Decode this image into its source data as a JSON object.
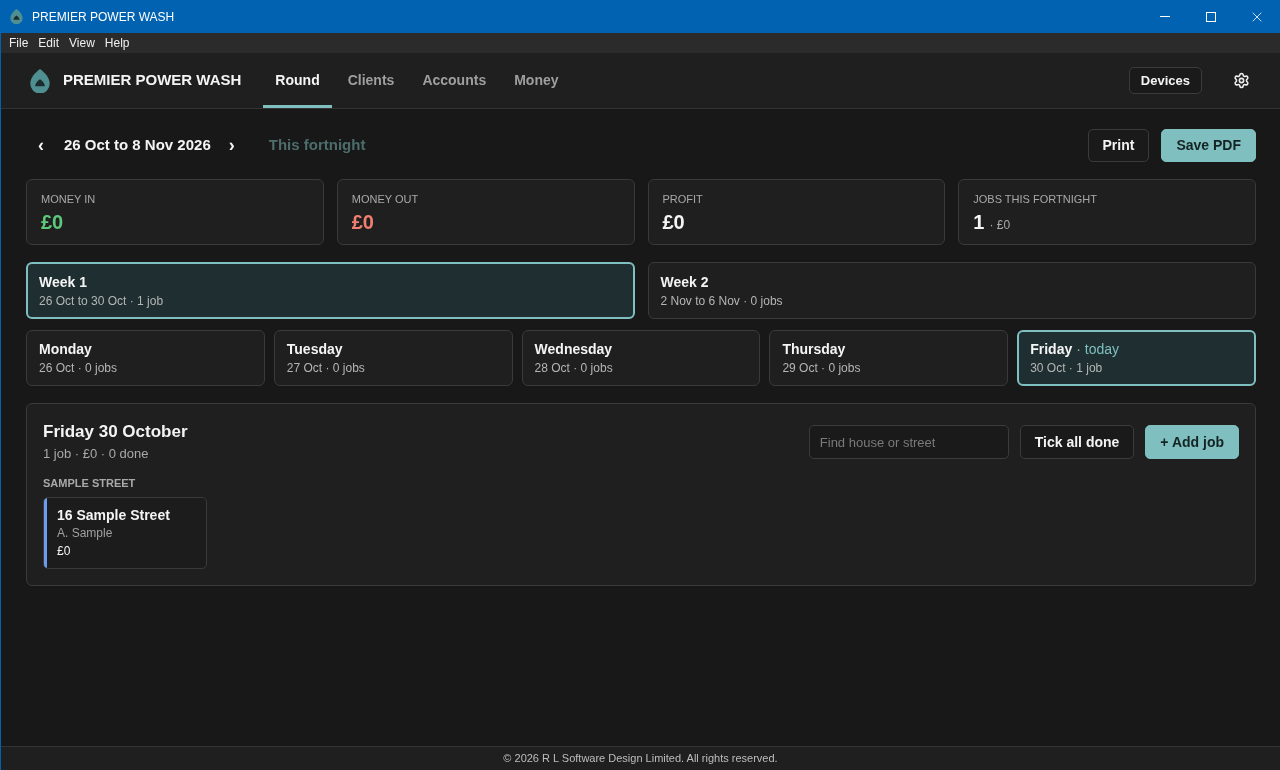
{
  "window": {
    "title": "PREMIER POWER WASH"
  },
  "menu_bar": [
    "File",
    "Edit",
    "View",
    "Help"
  ],
  "header": {
    "brand": "PREMIER POWER WASH",
    "tabs": [
      {
        "label": "Round",
        "selected": true
      },
      {
        "label": "Clients",
        "selected": false
      },
      {
        "label": "Accounts",
        "selected": false
      },
      {
        "label": "Money",
        "selected": false
      }
    ],
    "devices_button": "Devices"
  },
  "date_nav": {
    "prev": "‹",
    "range": "26 Oct to 8 Nov 2026",
    "next": "›",
    "shortcut": "This fortnight"
  },
  "actions": [
    {
      "label": "Print",
      "kind": "secondary"
    },
    {
      "label": "Save PDF",
      "kind": "primary"
    }
  ],
  "stats": [
    {
      "label": "MONEY IN",
      "value": "£0",
      "color": "#5cc97b"
    },
    {
      "label": "MONEY OUT",
      "value": "£0",
      "color": "#f07f70"
    },
    {
      "label": "PROFIT",
      "value": "£0",
      "color": "#f4f4f4"
    },
    {
      "label": "JOBS THIS FORTNIGHT",
      "value": "1",
      "detail": "· £0",
      "color": "#f4f4f4"
    }
  ],
  "weeks": [
    {
      "name": "Week 1",
      "detail": "26 Oct to 30 Oct · 1 job",
      "selected": true
    },
    {
      "name": "Week 2",
      "detail": "2 Nov to 6 Nov · 0 jobs",
      "selected": false
    }
  ],
  "days": [
    {
      "name": "Monday",
      "detail": "26 Oct · 0 jobs",
      "selected": false
    },
    {
      "name": "Tuesday",
      "detail": "27 Oct · 0 jobs",
      "selected": false
    },
    {
      "name": "Wednesday",
      "detail": "28 Oct · 0 jobs",
      "selected": false
    },
    {
      "name": "Thursday",
      "detail": "29 Oct · 0 jobs",
      "selected": false
    },
    {
      "name": "Friday",
      "note": "· today",
      "detail": "30 Oct · 1 job",
      "selected": true
    }
  ],
  "day_panel": {
    "title": "Friday 30 October",
    "summary": "1 job · £0 · 0 done",
    "search": {
      "placeholder": "Find house or street"
    },
    "buttons": [
      {
        "label": "Tick all done",
        "kind": "secondary"
      },
      {
        "label": "+ Add job",
        "kind": "primary"
      }
    ],
    "groups": [
      {
        "street": "SAMPLE STREET",
        "jobs": [
          {
            "address": "16 Sample Street",
            "client": "A. Sample",
            "price": "£0",
            "color": "#6b9cf0"
          }
        ]
      }
    ]
  },
  "footer": "© 2026 R L Software Design Limited. All rights reserved."
}
